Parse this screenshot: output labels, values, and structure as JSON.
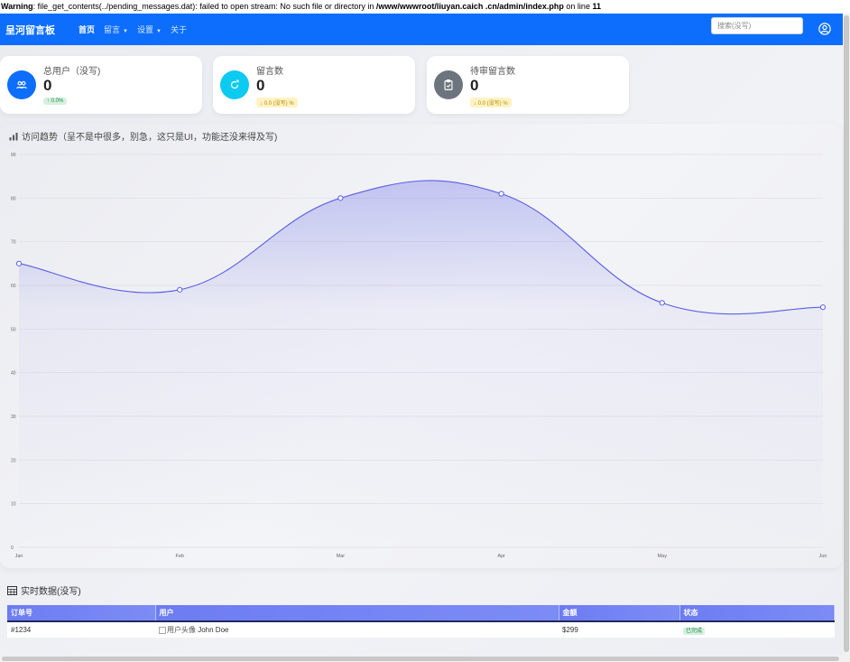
{
  "warning": {
    "label": "Warning",
    "message": ": file_get_contents(../pending_messages.dat): failed to open stream: No such file or directory in ",
    "path": "/www/wwwroot/liuyan.caich      .cn/admin/index.php",
    "on_line": " on line ",
    "line": "11"
  },
  "nav": {
    "brand": "呈河留言板",
    "items": [
      {
        "label": "首页",
        "active": true,
        "dropdown": false
      },
      {
        "label": "留言",
        "active": false,
        "dropdown": true
      },
      {
        "label": "设置",
        "active": false,
        "dropdown": true
      },
      {
        "label": "关于",
        "active": false,
        "dropdown": false
      }
    ],
    "search_placeholder": "搜索(没写)"
  },
  "stats": [
    {
      "label": "总用户（没写)",
      "value": "0",
      "badge": "↑ 0.0%",
      "color": "#0d6efd",
      "badge_style": "green",
      "icon": "users-icon"
    },
    {
      "label": "留言数",
      "value": "0",
      "badge": "↓ 0.0 (没写) %",
      "color": "#0dcaf0",
      "badge_style": "yellow",
      "icon": "refresh-icon"
    },
    {
      "label": "待审留言数",
      "value": "0",
      "badge": "↓ 0.0 (没写) %",
      "color": "#6c757d",
      "badge_style": "yellow",
      "icon": "clipboard-icon"
    }
  ],
  "chart": {
    "title": "访问趋势（呈不是中很多，别急，这只是UI，功能还没来得及写)"
  },
  "chart_data": {
    "type": "area",
    "x": [
      "Jan",
      "Feb",
      "Mar",
      "Apr",
      "May",
      "Jun"
    ],
    "series": [
      {
        "values": [
          65,
          59,
          80,
          81,
          56,
          55
        ]
      }
    ],
    "ylim": [
      0,
      90
    ],
    "yticks": [
      0,
      10,
      20,
      30,
      40,
      50,
      60,
      70,
      80,
      90
    ],
    "grid": true,
    "line_color": "#5b5fe0"
  },
  "table": {
    "title": "实时数据(没写)",
    "headers": [
      "订单号",
      "用户",
      "金额",
      "状态"
    ],
    "rows": [
      {
        "order": "#1234",
        "avatar_alt": "用户头像",
        "user": "John Doe",
        "amount": "$299",
        "status": "已完成"
      }
    ]
  }
}
